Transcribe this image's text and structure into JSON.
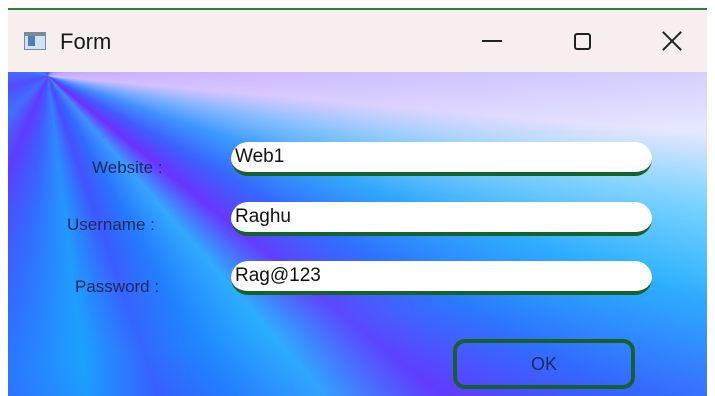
{
  "window": {
    "title": "Form",
    "icons": {
      "app": "app-form-icon",
      "minimize": "minimize-icon",
      "maximize": "maximize-icon",
      "close": "close-icon"
    }
  },
  "form": {
    "website": {
      "label": "Website :",
      "value": "Web1"
    },
    "username": {
      "label": "Username :",
      "value": "Raghu"
    },
    "password": {
      "label": "Password :",
      "value": "Rag@123"
    },
    "ok_label": "OK"
  },
  "colors": {
    "field_underline": "#14632b",
    "button_border": "#16602a",
    "label_text": "#1e2a55"
  }
}
